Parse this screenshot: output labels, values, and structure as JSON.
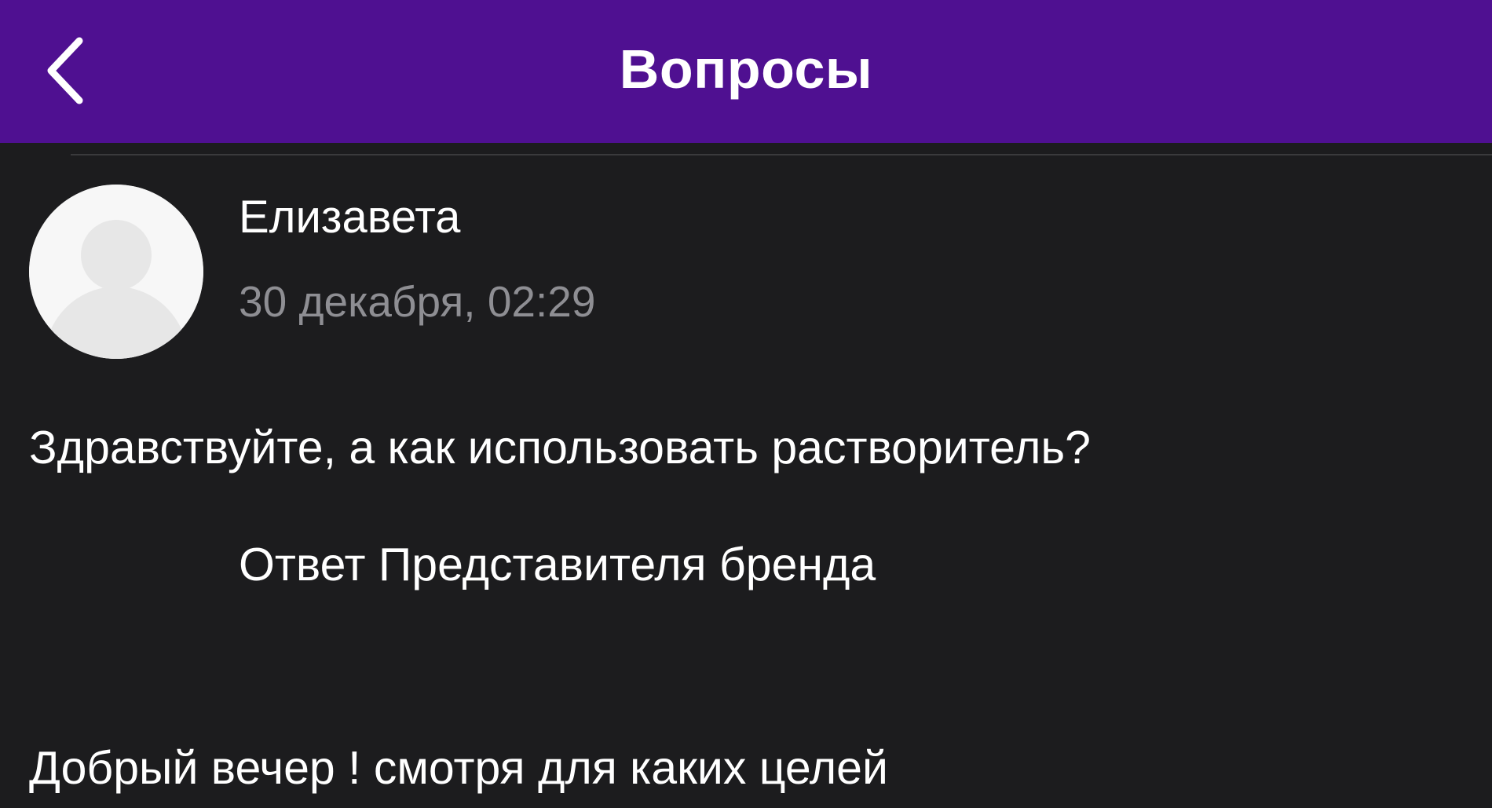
{
  "navbar": {
    "title": "Вопросы",
    "back_icon": "chevron-left-icon",
    "background": "#4f1091"
  },
  "question": {
    "author_name": "Елизавета",
    "date": "30 декабря, 02:29",
    "avatar_icon": "default-user-avatar-icon",
    "text": "Здравствуйте, а как использовать растворитель?"
  },
  "answer": {
    "header": "Ответ Представителя бренда",
    "text": "Добрый вечер ! смотря для каких целей"
  }
}
